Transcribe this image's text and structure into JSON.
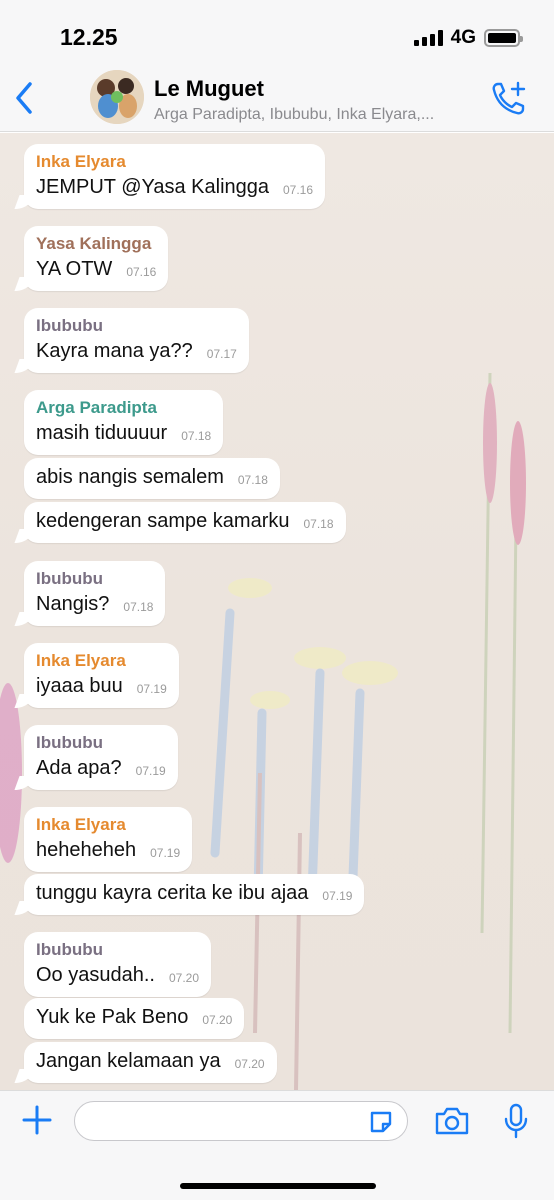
{
  "status": {
    "time": "12.25",
    "network": "4G"
  },
  "header": {
    "title": "Le Muguet",
    "subtitle": "Arga Paradipta, Ibububu, Inka Elyara,..."
  },
  "colors": {
    "accent": "#1a7cf5",
    "Inka Elyara": "#e58a2f",
    "Yasa Kalingga": "#a0705a",
    "Ibububu": "#7a7082",
    "Arga Paradipta": "#3d9a8c"
  },
  "messages": [
    {
      "sender": "Inka Elyara",
      "text": "JEMPUT @Yasa Kalingga",
      "time": "07.16"
    },
    {
      "sender": "Yasa Kalingga",
      "text": "YA OTW",
      "time": "07.16"
    },
    {
      "sender": "Ibububu",
      "text": "Kayra mana ya??",
      "time": "07.17"
    },
    {
      "sender": "Arga Paradipta",
      "text": "masih tiduuuur",
      "time": "07.18"
    },
    {
      "sender": "",
      "text": "abis nangis semalem",
      "time": "07.18"
    },
    {
      "sender": "",
      "text": "kedengeran sampe kamarku",
      "time": "07.18"
    },
    {
      "sender": "Ibububu",
      "text": "Nangis?",
      "time": "07.18"
    },
    {
      "sender": "Inka Elyara",
      "text": "iyaaa buu",
      "time": "07.19"
    },
    {
      "sender": "Ibububu",
      "text": "Ada apa?",
      "time": "07.19"
    },
    {
      "sender": "Inka Elyara",
      "text": "heheheheh",
      "time": "07.19"
    },
    {
      "sender": "",
      "text": "tunggu kayra cerita ke ibu ajaa",
      "time": "07.19"
    },
    {
      "sender": "Ibububu",
      "text": "Oo yasudah..",
      "time": "07.20"
    },
    {
      "sender": "",
      "text": "Yuk ke Pak Beno",
      "time": "07.20"
    },
    {
      "sender": "",
      "text": "Jangan kelamaan ya",
      "time": "07.20"
    }
  ],
  "icons": {
    "back": "chevron-left-icon",
    "call": "add-call-icon",
    "plus": "plus-icon",
    "sticker": "sticker-icon",
    "camera": "camera-icon",
    "mic": "microphone-icon"
  }
}
